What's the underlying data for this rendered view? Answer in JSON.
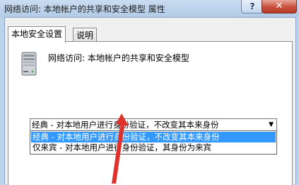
{
  "window": {
    "title": "网络访问: 本地帐户的共享和安全模型 属性",
    "help_glyph": "?",
    "close_glyph": "✕"
  },
  "tabs": [
    {
      "label": "本地安全设置",
      "active": true
    },
    {
      "label": "说明",
      "active": false
    }
  ],
  "policy": {
    "icon": "server-icon",
    "description": "网络访问: 本地帐户的共享和安全模型"
  },
  "dropdown": {
    "selected_value": "经典 - 对本地用户进行身份验证，不改变其本来身份",
    "arrow_glyph": "▼",
    "options": [
      "经典 - 对本地用户进行身份验证，不改变其本来身份",
      "仅来宾 - 对本地用户进行身份验证，其身份为来宾"
    ],
    "highlighted_index": 0
  },
  "colors": {
    "selection": "#3399ff",
    "annotation_arrow": "#e0322d",
    "title_bar": "#bcd3ec"
  }
}
